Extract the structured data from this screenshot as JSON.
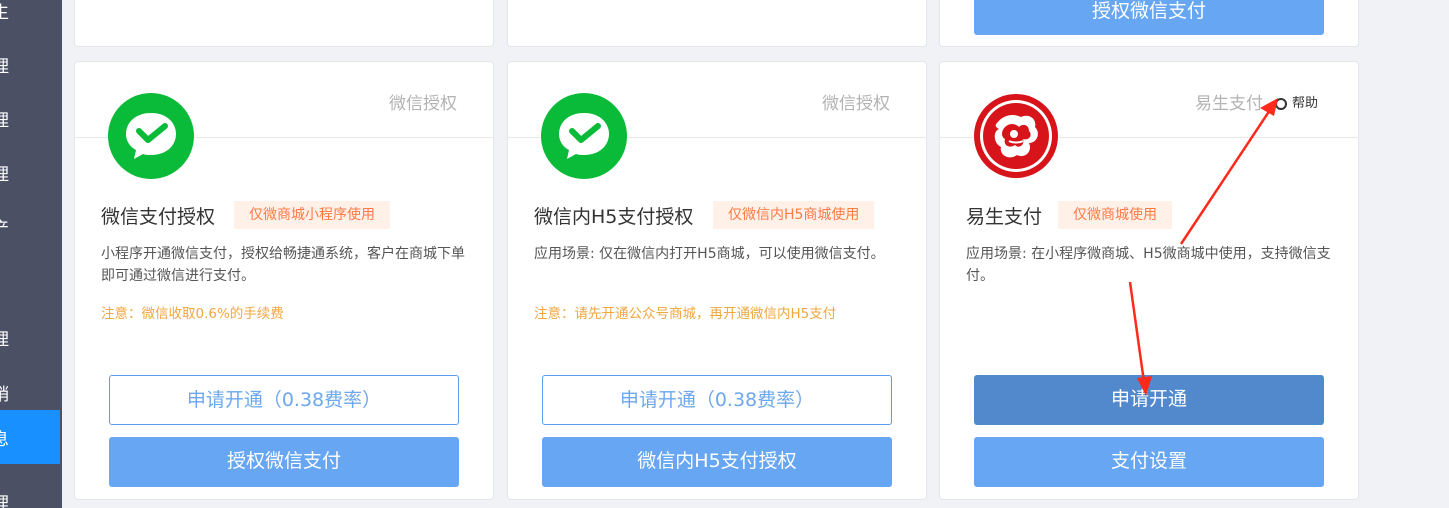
{
  "sidebar": {
    "items": [
      {
        "label": "生"
      },
      {
        "label": "理"
      },
      {
        "label": "理"
      },
      {
        "label": "理"
      },
      {
        "label": "产"
      },
      {
        "label": "理"
      },
      {
        "label": "销"
      },
      {
        "label": "息"
      },
      {
        "label": "理"
      }
    ]
  },
  "top_cards": {
    "card3_button": "授权微信支付"
  },
  "cards": [
    {
      "tag": "微信授权",
      "name": "微信支付授权",
      "badge": "仅微商城小程序使用",
      "desc": "小程序开通微信支付，授权给畅捷通系统，客户在商城下单即可通过微信进行支付。",
      "note": "注意：微信收取0.6%的手续费",
      "btn_primary": "申请开通（0.38费率）",
      "btn_secondary": "授权微信支付"
    },
    {
      "tag": "微信授权",
      "name": "微信内H5支付授权",
      "badge": "仅微信内H5商城使用",
      "desc": "应用场景: 仅在微信内打开H5商城，可以使用微信支付。",
      "note": "注意：请先开通公众号商城，再开通微信内H5支付",
      "btn_primary": "申请开通（0.38费率）",
      "btn_secondary": "微信内H5支付授权"
    },
    {
      "tag": "易生支付",
      "help": "帮助",
      "name": "易生支付",
      "badge": "仅微商城使用",
      "desc": "应用场景: 在小程序微商城、H5微商城中使用，支持微信支付。",
      "btn_primary": "申请开通",
      "btn_secondary": "支付设置"
    }
  ],
  "colors": {
    "sidebar_bg": "#4b5064",
    "sidebar_active": "#1890ff",
    "primary_button": "#66a6f2",
    "wechat_green": "#09bb38",
    "note_orange": "#f0a740",
    "annotation_red": "#ff2a1a"
  }
}
